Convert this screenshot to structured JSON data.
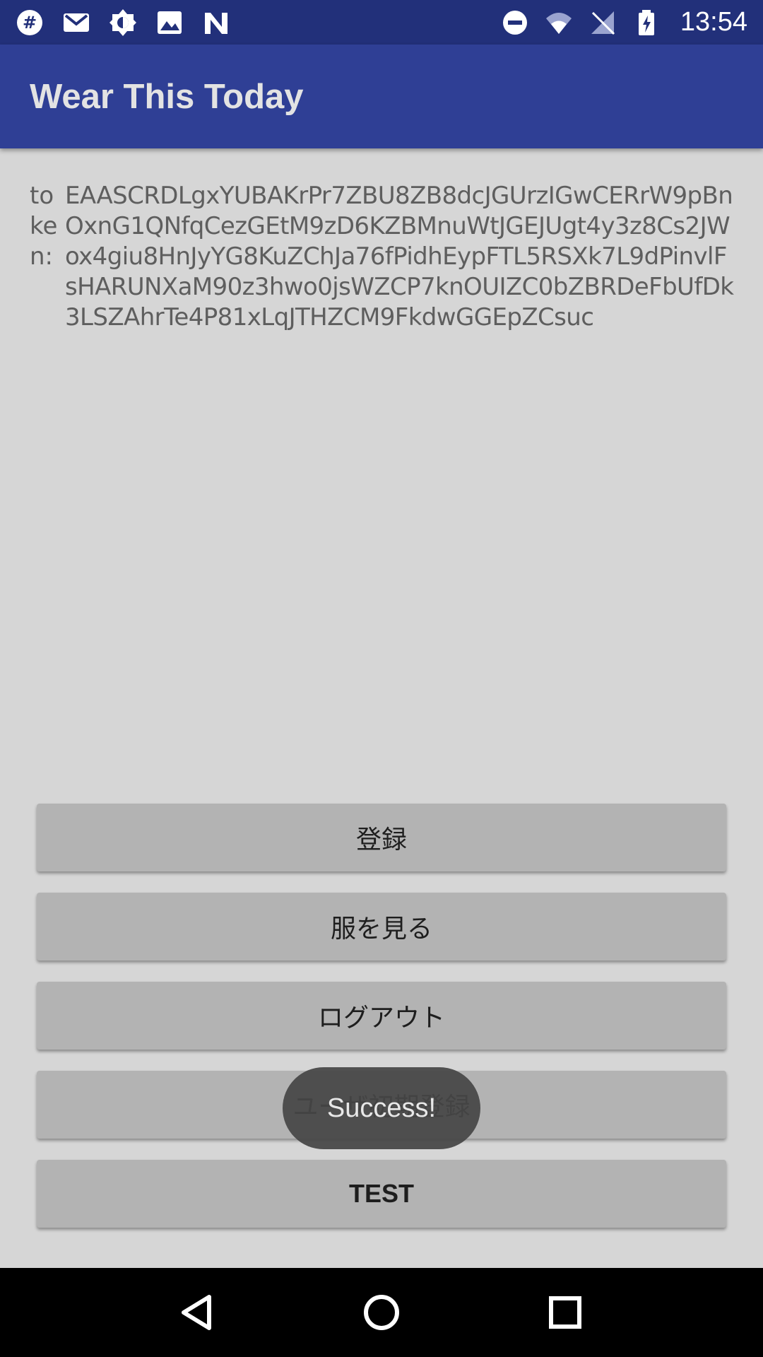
{
  "status_bar": {
    "time": "13:54",
    "left_icons": [
      "slack-icon",
      "gmail-icon",
      "brightness-icon",
      "image-icon",
      "n-app-icon"
    ],
    "right_icons": [
      "do-not-disturb-icon",
      "wifi-icon",
      "no-sim-icon",
      "battery-icon"
    ]
  },
  "app_bar": {
    "title": "Wear This Today"
  },
  "token": {
    "label": "token:",
    "value": "EAASCRDLgxYUBAKrPr7ZBU8ZB8dcJGUrzIGwCERrW9pBnOxnG1QNfqCezGEtM9zD6KZBMnuWtJGEJUgt4y3z8Cs2JWox4giu8HnJyYG8KuZChJa76fPidhEypFTL5RSXk7L9dPinvlFsHARUNXaM90z3hwo0jsWZCP7knOUIZC0bZBRDeFbUfDk3LSZAhrTe4P81xLqJTHZCM9FkdwGGEpZCsuc"
  },
  "buttons": {
    "register": "登録",
    "view_clothes": "服を見る",
    "logout": "ログアウト",
    "user_initial_registration": "ユーザ初期登録",
    "test": "TEST"
  },
  "toast": {
    "message": "Success!"
  },
  "colors": {
    "status_bar": "#22307a",
    "app_bar": "#2f3f95",
    "background": "#d6d6d6",
    "button": "#b3b3b3",
    "toast": "#464646"
  }
}
